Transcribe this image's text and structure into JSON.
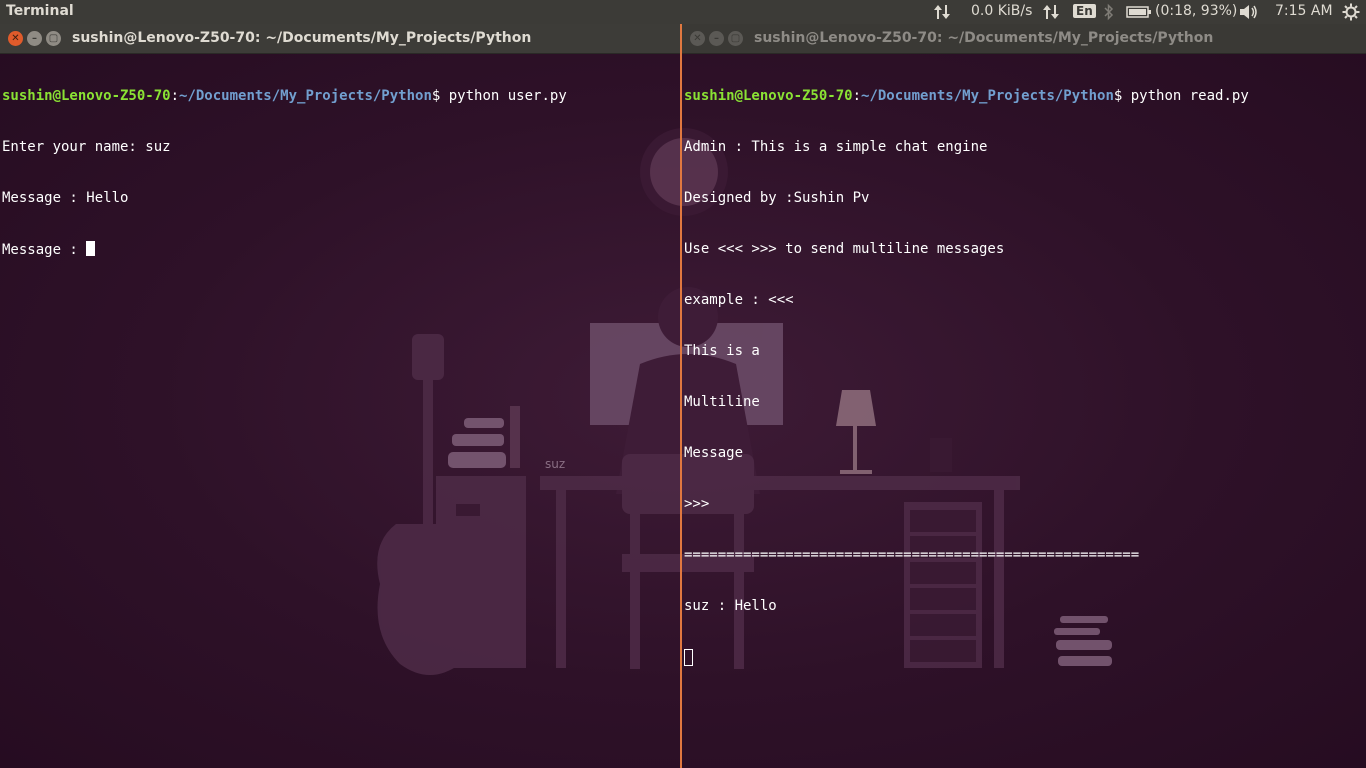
{
  "panel": {
    "app_name": "Terminal",
    "network_speed": "0.0 KiB/s",
    "keyboard_layout": "En",
    "battery": "(0:18, 93%)",
    "clock": "7:15 AM"
  },
  "wallpaper": {
    "desk_label": "suz"
  },
  "left_window": {
    "title": "sushin@Lenovo-Z50-70: ~/Documents/My_Projects/Python",
    "prompt_user": "sushin@Lenovo-Z50-70",
    "prompt_sep": ":",
    "prompt_path": "~/Documents/My_Projects/Python",
    "prompt_cmd": "$ python user.py",
    "lines": [
      "Enter your name: suz",
      "Message : Hello",
      "Message : "
    ]
  },
  "right_window": {
    "title": "sushin@Lenovo-Z50-70: ~/Documents/My_Projects/Python",
    "prompt_user": "sushin@Lenovo-Z50-70",
    "prompt_sep": ":",
    "prompt_path": "~/Documents/My_Projects/Python",
    "prompt_cmd": "$ python read.py",
    "lines": [
      "Admin : This is a simple chat engine",
      "Designed by :Sushin Pv",
      "Use <<< >>> to send multiline messages",
      "example : <<<",
      "This is a",
      "Multiline",
      "Message",
      ">>>",
      "======================================================",
      "suz : Hello"
    ]
  },
  "colors": {
    "prompt_user": "#8ae234",
    "prompt_path": "#729fcf",
    "divider": "#e07840"
  }
}
